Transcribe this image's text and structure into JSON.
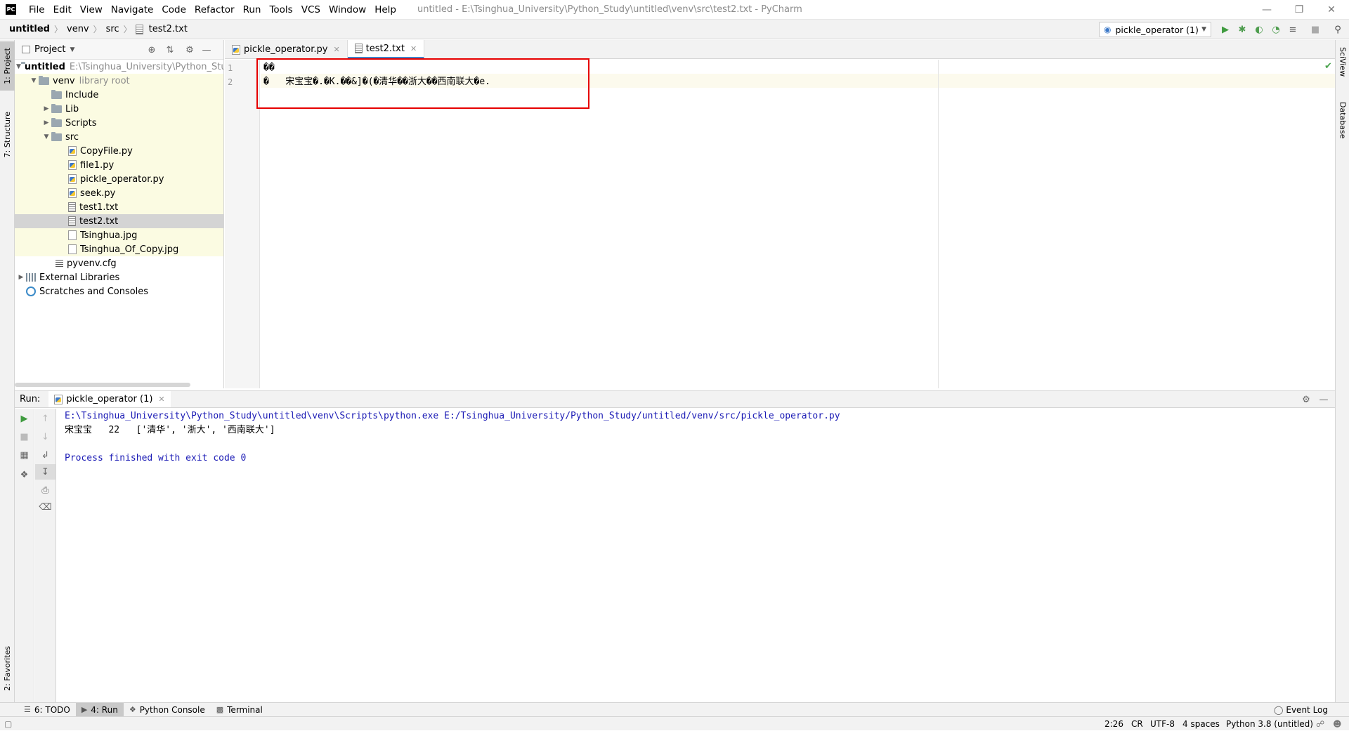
{
  "window": {
    "title": "untitled - E:\\Tsinghua_University\\Python_Study\\untitled\\venv\\src\\test2.txt - PyCharm",
    "menu": [
      "File",
      "Edit",
      "View",
      "Navigate",
      "Code",
      "Refactor",
      "Run",
      "Tools",
      "VCS",
      "Window",
      "Help"
    ]
  },
  "breadcrumb": [
    "untitled",
    "venv",
    "src",
    "test2.txt"
  ],
  "run_config": {
    "label": "pickle_operator (1)"
  },
  "left_strip": {
    "project": "1: Project",
    "structure": "7: Structure",
    "favorites": "2: Favorites"
  },
  "right_strip": {
    "sciview": "SciView",
    "database": "Database"
  },
  "project": {
    "title": "Project",
    "tree": [
      {
        "label": "untitled",
        "extra": "E:\\Tsinghua_University\\Python_Stud"
      },
      {
        "label": "venv",
        "extra": "library root"
      },
      {
        "label": "Include"
      },
      {
        "label": "Lib"
      },
      {
        "label": "Scripts"
      },
      {
        "label": "src"
      },
      {
        "label": "CopyFile.py"
      },
      {
        "label": "file1.py"
      },
      {
        "label": "pickle_operator.py"
      },
      {
        "label": "seek.py"
      },
      {
        "label": "test1.txt"
      },
      {
        "label": "test2.txt"
      },
      {
        "label": "Tsinghua.jpg"
      },
      {
        "label": "Tsinghua_Of_Copy.jpg"
      },
      {
        "label": "pyvenv.cfg"
      },
      {
        "label": "External Libraries"
      },
      {
        "label": "Scratches and Consoles"
      }
    ]
  },
  "editor": {
    "tabs": [
      "pickle_operator.py",
      "test2.txt"
    ],
    "active_tab": "test2.txt",
    "line_numbers": [
      "1",
      "2"
    ],
    "lines": [
      "�\u0003�",
      "�   宋宝宝�.�\u0016K\u0016.�\u0006�&]�(�\u0006清华��\u0006浙大��\u0006西南联大�e."
    ]
  },
  "run": {
    "label": "Run:",
    "tab": "pickle_operator (1)",
    "console": [
      "E:\\Tsinghua_University\\Python_Study\\untitled\\venv\\Scripts\\python.exe E:/Tsinghua_University/Python_Study/untitled/venv/src/pickle_operator.py",
      "宋宝宝   22   ['清华', '浙大', '西南联大']",
      "",
      "Process finished with exit code 0"
    ]
  },
  "bottom_tabs": [
    "6: TODO",
    "4: Run",
    "Python Console",
    "Terminal"
  ],
  "event_log": "Event Log",
  "status": {
    "position": "2:26",
    "line_sep": "CR",
    "encoding": "UTF-8",
    "indent": "4 spaces",
    "interpreter": "Python 3.8 (untitled)"
  },
  "colors": {
    "accent": "#4083c9",
    "highlight_box": "#e60000",
    "console_blue": "#1a1ab5",
    "tree_highlight": "#fbfbe2"
  }
}
